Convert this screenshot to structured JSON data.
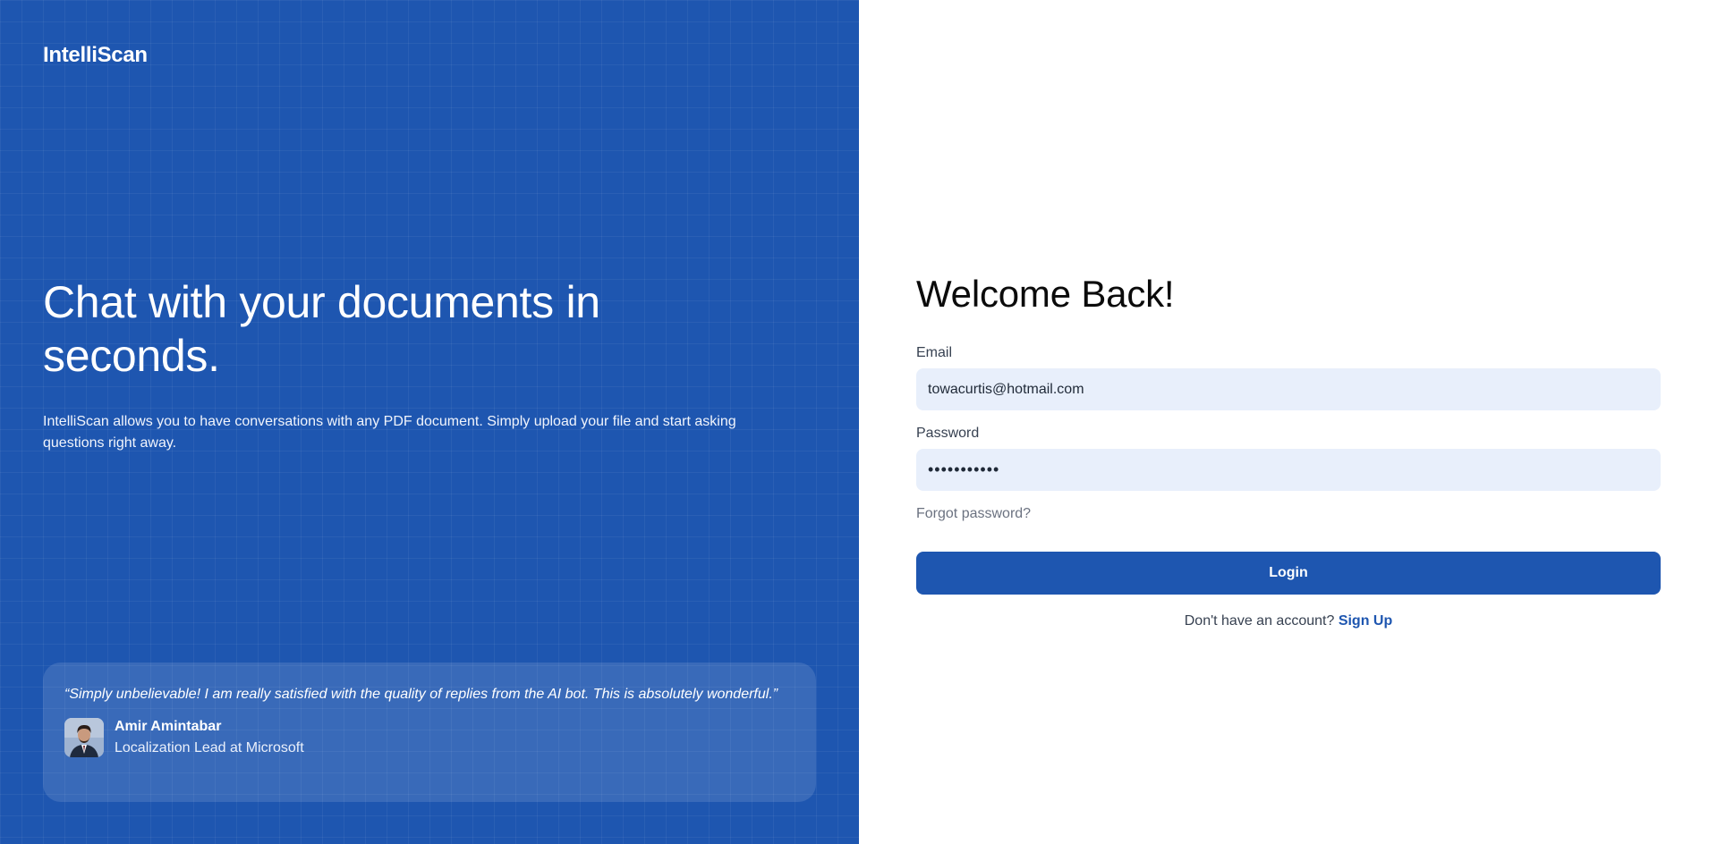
{
  "brand": {
    "logo_text": "IntelliScan"
  },
  "hero": {
    "title": "Chat with your documents in seconds.",
    "subtitle": "IntelliScan allows you to have conversations with any PDF document. Simply upload your file and start asking questions right away."
  },
  "testimonial": {
    "quote": "“Simply unbelievable! I am really satisfied with the quality of replies from the AI bot. This is absolutely wonderful.”",
    "author_name": "Amir Amintabar",
    "author_role": "Localization Lead at Microsoft"
  },
  "login": {
    "title": "Welcome Back!",
    "email_label": "Email",
    "email_value": "towacurtis@hotmail.com",
    "password_label": "Password",
    "password_value": "•••••••••••",
    "forgot_password": "Forgot password?",
    "login_button": "Login",
    "signup_prompt": "Don't have an account?",
    "signup_link": "Sign Up"
  },
  "colors": {
    "brand_blue": "#1e56b0",
    "input_bg": "#e8effb"
  }
}
